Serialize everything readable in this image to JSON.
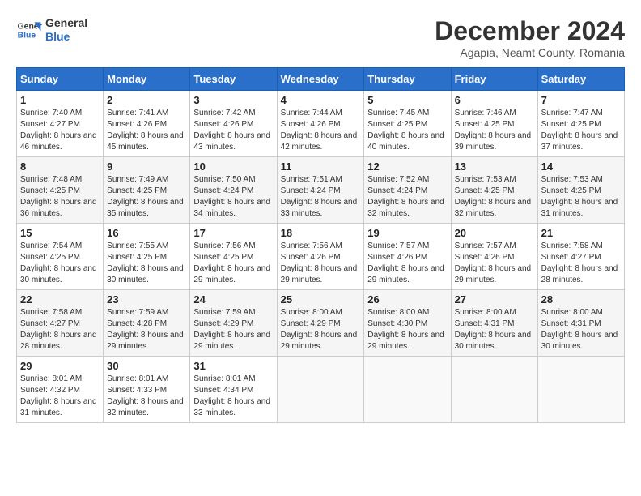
{
  "header": {
    "logo_line1": "General",
    "logo_line2": "Blue",
    "month_year": "December 2024",
    "location": "Agapia, Neamt County, Romania"
  },
  "weekdays": [
    "Sunday",
    "Monday",
    "Tuesday",
    "Wednesday",
    "Thursday",
    "Friday",
    "Saturday"
  ],
  "weeks": [
    [
      {
        "day": "1",
        "info": "Sunrise: 7:40 AM\nSunset: 4:27 PM\nDaylight: 8 hours and 46 minutes."
      },
      {
        "day": "2",
        "info": "Sunrise: 7:41 AM\nSunset: 4:26 PM\nDaylight: 8 hours and 45 minutes."
      },
      {
        "day": "3",
        "info": "Sunrise: 7:42 AM\nSunset: 4:26 PM\nDaylight: 8 hours and 43 minutes."
      },
      {
        "day": "4",
        "info": "Sunrise: 7:44 AM\nSunset: 4:26 PM\nDaylight: 8 hours and 42 minutes."
      },
      {
        "day": "5",
        "info": "Sunrise: 7:45 AM\nSunset: 4:25 PM\nDaylight: 8 hours and 40 minutes."
      },
      {
        "day": "6",
        "info": "Sunrise: 7:46 AM\nSunset: 4:25 PM\nDaylight: 8 hours and 39 minutes."
      },
      {
        "day": "7",
        "info": "Sunrise: 7:47 AM\nSunset: 4:25 PM\nDaylight: 8 hours and 37 minutes."
      }
    ],
    [
      {
        "day": "8",
        "info": "Sunrise: 7:48 AM\nSunset: 4:25 PM\nDaylight: 8 hours and 36 minutes."
      },
      {
        "day": "9",
        "info": "Sunrise: 7:49 AM\nSunset: 4:25 PM\nDaylight: 8 hours and 35 minutes."
      },
      {
        "day": "10",
        "info": "Sunrise: 7:50 AM\nSunset: 4:24 PM\nDaylight: 8 hours and 34 minutes."
      },
      {
        "day": "11",
        "info": "Sunrise: 7:51 AM\nSunset: 4:24 PM\nDaylight: 8 hours and 33 minutes."
      },
      {
        "day": "12",
        "info": "Sunrise: 7:52 AM\nSunset: 4:24 PM\nDaylight: 8 hours and 32 minutes."
      },
      {
        "day": "13",
        "info": "Sunrise: 7:53 AM\nSunset: 4:25 PM\nDaylight: 8 hours and 32 minutes."
      },
      {
        "day": "14",
        "info": "Sunrise: 7:53 AM\nSunset: 4:25 PM\nDaylight: 8 hours and 31 minutes."
      }
    ],
    [
      {
        "day": "15",
        "info": "Sunrise: 7:54 AM\nSunset: 4:25 PM\nDaylight: 8 hours and 30 minutes."
      },
      {
        "day": "16",
        "info": "Sunrise: 7:55 AM\nSunset: 4:25 PM\nDaylight: 8 hours and 30 minutes."
      },
      {
        "day": "17",
        "info": "Sunrise: 7:56 AM\nSunset: 4:25 PM\nDaylight: 8 hours and 29 minutes."
      },
      {
        "day": "18",
        "info": "Sunrise: 7:56 AM\nSunset: 4:26 PM\nDaylight: 8 hours and 29 minutes."
      },
      {
        "day": "19",
        "info": "Sunrise: 7:57 AM\nSunset: 4:26 PM\nDaylight: 8 hours and 29 minutes."
      },
      {
        "day": "20",
        "info": "Sunrise: 7:57 AM\nSunset: 4:26 PM\nDaylight: 8 hours and 29 minutes."
      },
      {
        "day": "21",
        "info": "Sunrise: 7:58 AM\nSunset: 4:27 PM\nDaylight: 8 hours and 28 minutes."
      }
    ],
    [
      {
        "day": "22",
        "info": "Sunrise: 7:58 AM\nSunset: 4:27 PM\nDaylight: 8 hours and 28 minutes."
      },
      {
        "day": "23",
        "info": "Sunrise: 7:59 AM\nSunset: 4:28 PM\nDaylight: 8 hours and 29 minutes."
      },
      {
        "day": "24",
        "info": "Sunrise: 7:59 AM\nSunset: 4:29 PM\nDaylight: 8 hours and 29 minutes."
      },
      {
        "day": "25",
        "info": "Sunrise: 8:00 AM\nSunset: 4:29 PM\nDaylight: 8 hours and 29 minutes."
      },
      {
        "day": "26",
        "info": "Sunrise: 8:00 AM\nSunset: 4:30 PM\nDaylight: 8 hours and 29 minutes."
      },
      {
        "day": "27",
        "info": "Sunrise: 8:00 AM\nSunset: 4:31 PM\nDaylight: 8 hours and 30 minutes."
      },
      {
        "day": "28",
        "info": "Sunrise: 8:00 AM\nSunset: 4:31 PM\nDaylight: 8 hours and 30 minutes."
      }
    ],
    [
      {
        "day": "29",
        "info": "Sunrise: 8:01 AM\nSunset: 4:32 PM\nDaylight: 8 hours and 31 minutes."
      },
      {
        "day": "30",
        "info": "Sunrise: 8:01 AM\nSunset: 4:33 PM\nDaylight: 8 hours and 32 minutes."
      },
      {
        "day": "31",
        "info": "Sunrise: 8:01 AM\nSunset: 4:34 PM\nDaylight: 8 hours and 33 minutes."
      },
      null,
      null,
      null,
      null
    ]
  ]
}
